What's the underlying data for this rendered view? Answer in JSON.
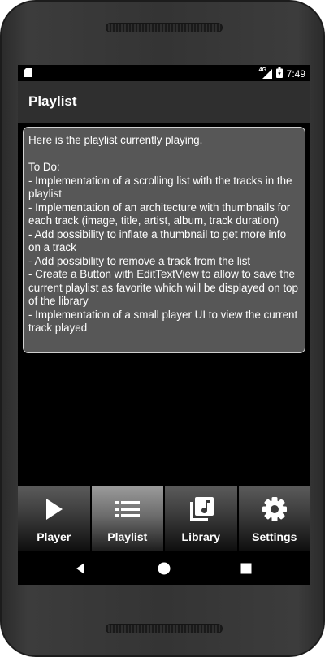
{
  "status_bar": {
    "network": "4G",
    "time": "7:49"
  },
  "action_bar": {
    "title": "Playlist"
  },
  "content": {
    "lines": [
      "Here is the playlist currently playing.",
      "",
      "To Do:",
      "- Implementation of a scrolling list with the tracks in the playlist",
      "- Implementation of an architecture with thumbnails for each track (image, title, artist, album, track duration)",
      "- Add possibility to inflate a thumbnail to get more info on a track",
      "- Add possibility to remove a track from the list",
      "- Create a Button with EditTextView to allow to save the current playlist as favorite which will be displayed on top of the library",
      "- Implementation of a small player UI to view the current track played"
    ]
  },
  "bottom_nav": {
    "tabs": [
      {
        "label": "Player",
        "icon": "play-icon",
        "active": false
      },
      {
        "label": "Playlist",
        "icon": "list-icon",
        "active": true
      },
      {
        "label": "Library",
        "icon": "library-music-icon",
        "active": false
      },
      {
        "label": "Settings",
        "icon": "gear-icon",
        "active": false
      }
    ]
  },
  "system_nav": {
    "buttons": [
      "back-icon",
      "home-icon",
      "recents-icon"
    ]
  }
}
